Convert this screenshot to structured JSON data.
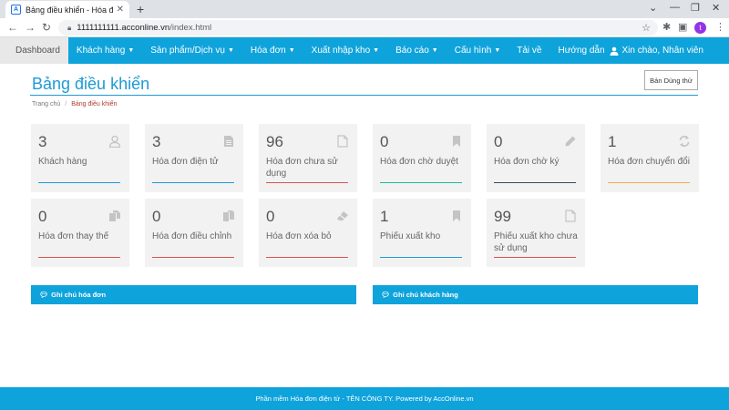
{
  "browser": {
    "tab_title": "Bảng điều khiển - Hóa đơn điện",
    "favicon_letter": "A",
    "url_host": "1111111111.acconline.vn",
    "url_path": "/index.html",
    "profile_initial": "t"
  },
  "navbar": {
    "items": [
      {
        "label": "Dashboard",
        "active": true,
        "dropdown": false
      },
      {
        "label": "Khách hàng",
        "dropdown": true
      },
      {
        "label": "Sản phẩm/Dịch vụ",
        "dropdown": true
      },
      {
        "label": "Hóa đơn",
        "dropdown": true
      },
      {
        "label": "Xuất nhập kho",
        "dropdown": true
      },
      {
        "label": "Báo cáo",
        "dropdown": true
      },
      {
        "label": "Cấu hình",
        "dropdown": true
      },
      {
        "label": "Tải về",
        "dropdown": false
      },
      {
        "label": "Hướng dẫn",
        "dropdown": false
      }
    ],
    "user_greeting": "Xin chào, Nhân viên"
  },
  "header": {
    "title": "Bảng điều khiển",
    "trial_button": "Bản Dùng thử"
  },
  "breadcrumb": {
    "home": "Trang chủ",
    "current": "Bảng điều khiển"
  },
  "cards": [
    {
      "value": "3",
      "label": "Khách hàng",
      "icon": "user-icon",
      "accent": "#1e9ad6"
    },
    {
      "value": "3",
      "label": "Hóa đơn điện tử",
      "icon": "document-icon",
      "accent": "#1e9ad6"
    },
    {
      "value": "96",
      "label": "Hóa đơn chưa sử dụng",
      "icon": "file-icon",
      "accent": "#d9534f"
    },
    {
      "value": "0",
      "label": "Hóa đơn chờ duyệt",
      "icon": "bookmark-icon",
      "accent": "#1abc9c"
    },
    {
      "value": "0",
      "label": "Hóa đơn chờ ký",
      "icon": "pencil-icon",
      "accent": "#34495e"
    },
    {
      "value": "1",
      "label": "Hóa đơn chuyển đổi",
      "icon": "refresh-icon",
      "accent": "#f0ad4e"
    },
    {
      "value": "0",
      "label": "Hóa đơn thay thế",
      "icon": "copy-icon",
      "accent": "#d9534f"
    },
    {
      "value": "0",
      "label": "Hóa đơn điều chỉnh",
      "icon": "clipboard-icon",
      "accent": "#d9534f"
    },
    {
      "value": "0",
      "label": "Hóa đơn xóa bỏ",
      "icon": "eraser-icon",
      "accent": "#d9534f"
    },
    {
      "value": "1",
      "label": "Phiếu xuất kho",
      "icon": "bookmark-icon",
      "accent": "#1e9ad6"
    },
    {
      "value": "99",
      "label": "Phiếu xuất kho chưa sử dụng",
      "icon": "file-icon",
      "accent": "#d9534f"
    }
  ],
  "panels": {
    "invoice_notes": "Ghi chú hóa đơn",
    "customer_notes": "Ghi chú khách hàng"
  },
  "footer": {
    "text": "Phần mềm Hóa đơn điện tử - TÊN CÔNG TY. Powered by AccOnline.vn"
  }
}
